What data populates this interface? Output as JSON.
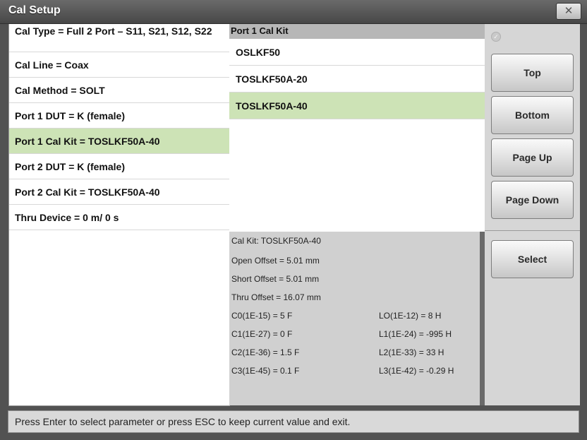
{
  "window": {
    "title": "Cal Setup",
    "close_glyph": "✕"
  },
  "params": [
    {
      "label": "Cal Type = Full 2 Port – S11, S21, S12, S22",
      "selected": false
    },
    {
      "label": "Cal Line = Coax",
      "selected": false
    },
    {
      "label": "Cal Method = SOLT",
      "selected": false
    },
    {
      "label": "Port 1 DUT = K (female)",
      "selected": false
    },
    {
      "label": "Port 1 Cal Kit = TOSLKF50A-40",
      "selected": true
    },
    {
      "label": "Port 2 DUT = K (female)",
      "selected": false
    },
    {
      "label": "Port 2 Cal Kit = TOSLKF50A-40",
      "selected": false
    },
    {
      "label": "Thru Device = 0 m/ 0 s",
      "selected": false
    }
  ],
  "kit_list": {
    "header": "Port 1 Cal Kit",
    "items": [
      {
        "label": "OSLKF50",
        "selected": false
      },
      {
        "label": "TOSLKF50A-20",
        "selected": false
      },
      {
        "label": "TOSLKF50A-40",
        "selected": true
      }
    ]
  },
  "details": {
    "kit": "Cal Kit: TOSLKF50A-40",
    "open_offset": "Open Offset = 5.01 mm",
    "short_offset": "Short Offset = 5.01 mm",
    "thru_offset": "Thru Offset = 16.07 mm",
    "c0": "C0(1E-15) = 5 F",
    "c1": "C1(1E-27) = 0 F",
    "c2": "C2(1E-36) = 1.5 F",
    "c3": "C3(1E-45) = 0.1 F",
    "l0": "LO(1E-12) = 8 H",
    "l1": "L1(1E-24) = -995 H",
    "l2": "L2(1E-33) = 33 H",
    "l3": "L3(1E-42) = -0.29 H"
  },
  "buttons": {
    "check_glyph": "✓",
    "top": "Top",
    "bottom": "Bottom",
    "page_up": "Page Up",
    "page_down": "Page Down",
    "select": "Select"
  },
  "status": "Press Enter to select parameter or press ESC to keep current value and exit."
}
